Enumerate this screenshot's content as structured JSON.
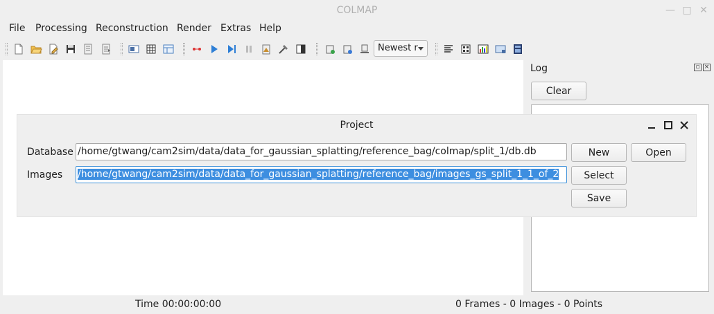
{
  "window": {
    "title": "COLMAP"
  },
  "menu": {
    "items": [
      "File",
      "Processing",
      "Reconstruction",
      "Render",
      "Extras",
      "Help"
    ]
  },
  "toolbar": {
    "combo_value": "Newest r",
    "icons": [
      "new-project-icon",
      "open-project-icon",
      "edit-project-icon",
      "save-project-icon",
      "import-model-icon",
      "export-model-icon",
      "database-management-icon",
      "feature-extraction-icon",
      "feature-matching-icon",
      "start-reconstruction-icon",
      "step-reconstruction-icon",
      "pause-reconstruction-icon",
      "reconstruction-options-icon",
      "bundle-adjustment-icon",
      "dense-reconstruction-icon",
      "render-options-icon",
      "grab-image-icon",
      "grab-movie-icon",
      "reconstruction-stats-icon",
      "match-matrix-icon",
      "log-icon",
      "show-model-icon"
    ]
  },
  "log": {
    "title": "Log",
    "clear_label": "Clear"
  },
  "status": {
    "time": "Time 00:00:00:00",
    "counts": "0 Frames - 0 Images - 0 Points"
  },
  "dialog": {
    "title": "Project",
    "database_label": "Database",
    "database_value": "/home/gtwang/cam2sim/data/data_for_gaussian_splatting/reference_bag/colmap/split_1/db.db",
    "images_label": "Images",
    "images_value": "/home/gtwang/cam2sim/data/data_for_gaussian_splatting/reference_bag/images_gs_split_1_1_of_2",
    "new_label": "New",
    "open_label": "Open",
    "select_label": "Select",
    "save_label": "Save"
  }
}
